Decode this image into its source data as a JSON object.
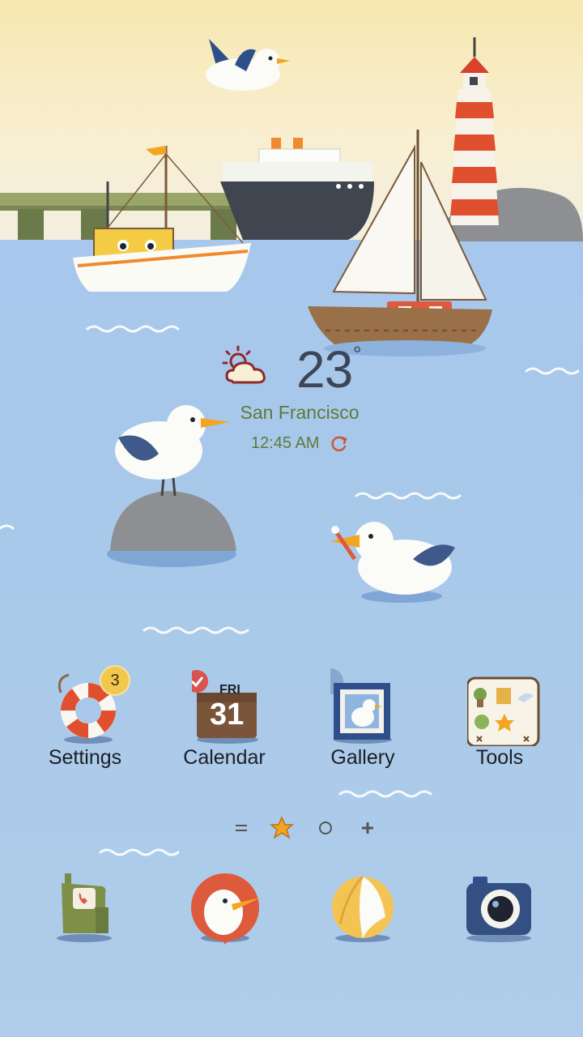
{
  "weather": {
    "temperature": "23",
    "degree_symbol": "°",
    "city": "San Francisco",
    "time": "12:45 AM",
    "icon": "partly-sunny-cloud-icon"
  },
  "apps": [
    {
      "label": "Settings",
      "icon": "life-ring-icon",
      "badge": "3"
    },
    {
      "label": "Calendar",
      "icon": "calendar-icon",
      "day": "FRI",
      "date": "31"
    },
    {
      "label": "Gallery",
      "icon": "gallery-seagull-icon"
    },
    {
      "label": "Tools",
      "icon": "tools-folder-icon"
    }
  ],
  "pager": {
    "items": [
      "menu-lines-icon",
      "star-home-icon",
      "circle-page-icon",
      "plus-icon"
    ],
    "active": "star-home-icon"
  },
  "dock": [
    {
      "icon": "phone-icon"
    },
    {
      "icon": "messages-bird-icon"
    },
    {
      "icon": "beach-ball-browser-icon"
    },
    {
      "icon": "camera-icon"
    }
  ],
  "colors": {
    "sky": "#f7e8b0",
    "sea": "#a9c8ea",
    "text_dark": "#1c1f24",
    "weather_text": "#5d7a3a",
    "badge": "#f1c84b"
  }
}
